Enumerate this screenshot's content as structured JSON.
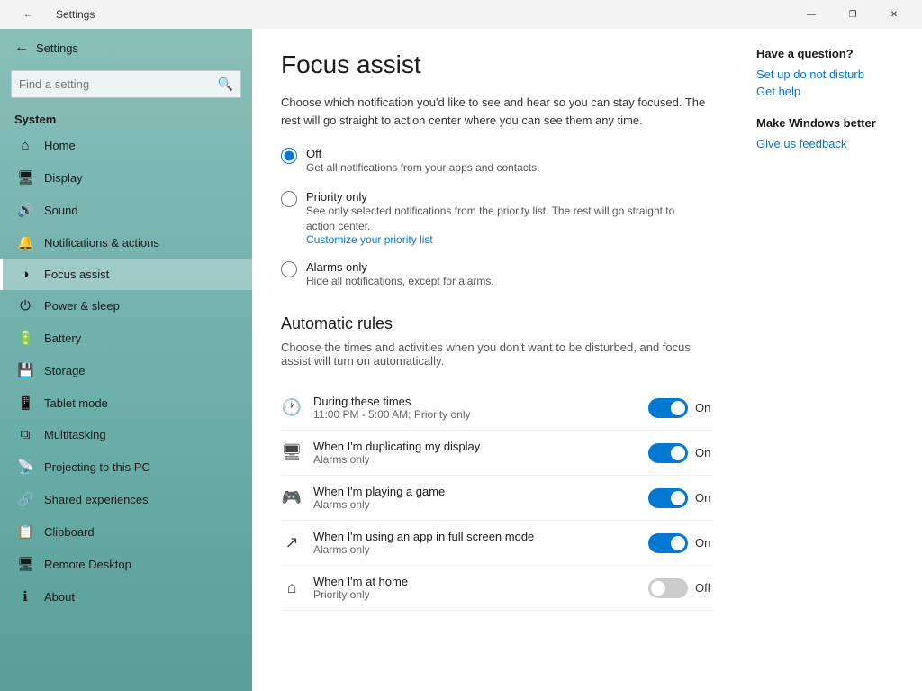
{
  "titlebar": {
    "back_icon": "←",
    "title": "Settings",
    "minimize": "—",
    "maximize": "❐",
    "close": "✕"
  },
  "sidebar": {
    "back_label": "Settings",
    "search_placeholder": "Find a setting",
    "search_icon": "🔍",
    "section_label": "System",
    "nav_items": [
      {
        "id": "home",
        "icon": "⌂",
        "label": "Home"
      },
      {
        "id": "display",
        "icon": "🖥",
        "label": "Display"
      },
      {
        "id": "sound",
        "icon": "🔊",
        "label": "Sound"
      },
      {
        "id": "notifications",
        "icon": "🔔",
        "label": "Notifications & actions"
      },
      {
        "id": "focus",
        "icon": "◑",
        "label": "Focus assist",
        "active": true
      },
      {
        "id": "power",
        "icon": "⏻",
        "label": "Power & sleep"
      },
      {
        "id": "battery",
        "icon": "🔋",
        "label": "Battery"
      },
      {
        "id": "storage",
        "icon": "💾",
        "label": "Storage"
      },
      {
        "id": "tablet",
        "icon": "📱",
        "label": "Tablet mode"
      },
      {
        "id": "multitasking",
        "icon": "⧉",
        "label": "Multitasking"
      },
      {
        "id": "projecting",
        "icon": "📡",
        "label": "Projecting to this PC"
      },
      {
        "id": "shared",
        "icon": "🔗",
        "label": "Shared experiences"
      },
      {
        "id": "clipboard",
        "icon": "📋",
        "label": "Clipboard"
      },
      {
        "id": "remote",
        "icon": "🖥",
        "label": "Remote Desktop"
      },
      {
        "id": "about",
        "icon": "ℹ",
        "label": "About"
      }
    ]
  },
  "main": {
    "page_title": "Focus assist",
    "description": "Choose which notification you'd like to see and hear so you can stay focused. The rest will go straight to action center where you can see them any time.",
    "radio_options": [
      {
        "id": "off",
        "label": "Off",
        "sublabel": "Get all notifications from your apps and contacts.",
        "checked": true,
        "link": null
      },
      {
        "id": "priority",
        "label": "Priority only",
        "sublabel": "See only selected notifications from the priority list. The rest will go straight to action center.",
        "checked": false,
        "link": "Customize your priority list"
      },
      {
        "id": "alarms",
        "label": "Alarms only",
        "sublabel": "Hide all notifications, except for alarms.",
        "checked": false,
        "link": null
      }
    ],
    "automatic_rules": {
      "title": "Automatic rules",
      "description": "Choose the times and activities when you don't want to be disturbed, and focus assist will turn on automatically.",
      "rules": [
        {
          "id": "during-times",
          "icon": "🕐",
          "title": "During these times",
          "subtitle": "11:00 PM - 5:00 AM; Priority only",
          "toggle": "on",
          "toggle_label": "On"
        },
        {
          "id": "duplicating",
          "icon": "🖥",
          "title": "When I'm duplicating my display",
          "subtitle": "Alarms only",
          "toggle": "on",
          "toggle_label": "On"
        },
        {
          "id": "gaming",
          "icon": "🎮",
          "title": "When I'm playing a game",
          "subtitle": "Alarms only",
          "toggle": "on",
          "toggle_label": "On",
          "annotated": true
        },
        {
          "id": "fullscreen",
          "icon": "↗",
          "title": "When I'm using an app in full screen mode",
          "subtitle": "Alarms only",
          "toggle": "on",
          "toggle_label": "On",
          "annotated": true
        },
        {
          "id": "home",
          "icon": "⌂",
          "title": "When I'm at home",
          "subtitle": "Priority only",
          "toggle": "off",
          "toggle_label": "Off"
        }
      ]
    }
  },
  "sidebar_panel": {
    "have_question": "Have a question?",
    "links": [
      {
        "label": "Set up do not disturb"
      },
      {
        "label": "Get help"
      }
    ],
    "make_better": "Make Windows better",
    "feedback_link": "Give us feedback"
  }
}
